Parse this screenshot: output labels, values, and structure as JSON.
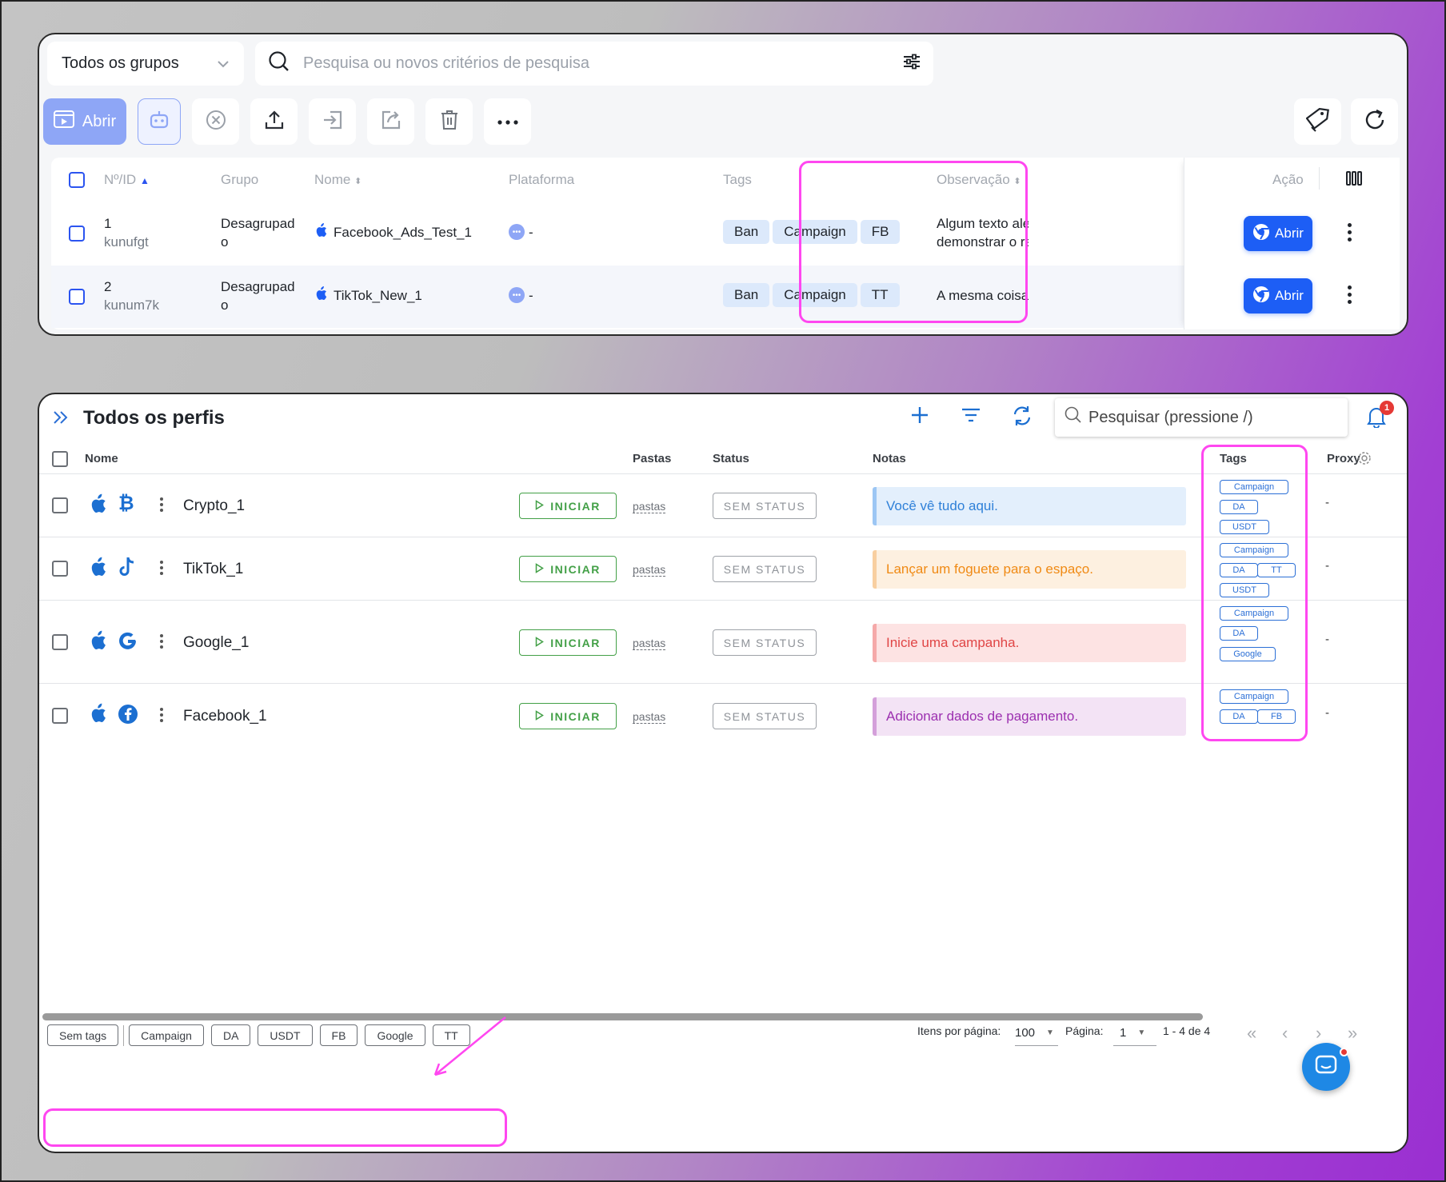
{
  "top": {
    "group_select": "Todos os grupos",
    "search_placeholder": "Pesquisa ou novos critérios de pesquisa",
    "open_label": "Abrir",
    "columns": {
      "id": "Nº/ID",
      "group": "Grupo",
      "name": "Nome",
      "platform": "Plataforma",
      "tags": "Tags",
      "observation": "Observação",
      "action": "Ação"
    },
    "rows": [
      {
        "num": "1",
        "id": "kunufgt",
        "group_line1": "Desagrupad",
        "group_line2": "o",
        "name": "Facebook_Ads_Test_1",
        "platform": "-",
        "tags": [
          "Ban",
          "Campaign",
          "FB"
        ],
        "obs_line1": "Algum texto aleat",
        "obs_line2": "demonstrar o recu",
        "action": "Abrir"
      },
      {
        "num": "2",
        "id": "kunum7k",
        "group_line1": "Desagrupad",
        "group_line2": "o",
        "name": "TikTok_New_1",
        "platform": "-",
        "tags": [
          "Ban",
          "Campaign",
          "TT"
        ],
        "obs_line1": "A mesma coisa a",
        "obs_line2": "",
        "action": "Abrir"
      }
    ]
  },
  "bottom": {
    "title": "Todos os perfis",
    "search_placeholder": "Pesquisar (pressione /)",
    "notification_count": "1",
    "columns": {
      "name": "Nome",
      "folders": "Pastas",
      "status": "Status",
      "notes": "Notas",
      "tags": "Tags",
      "proxy": "Proxy"
    },
    "start_label": "INICIAR",
    "folders_label": "pastas",
    "status_label": "SEM STATUS",
    "proxy_value": "-",
    "rows": [
      {
        "name": "Crypto_1",
        "app_icon": "bitcoin-icon",
        "note": "Você vê tudo aqui.",
        "note_color": "blue",
        "tags": [
          "Campaign",
          "DA",
          "USDT"
        ]
      },
      {
        "name": "TikTok_1",
        "app_icon": "tiktok-icon",
        "note": "Lançar um foguete para o espaço.",
        "note_color": "orange",
        "tags": [
          "Campaign",
          "DA",
          "TT",
          "USDT"
        ]
      },
      {
        "name": "Google_1",
        "app_icon": "google-icon",
        "note": "Inicie uma campanha.",
        "note_color": "red",
        "tags": [
          "Campaign",
          "DA",
          "Google"
        ]
      },
      {
        "name": "Facebook_1",
        "app_icon": "facebook-icon",
        "note": "Adicionar dados de pagamento.",
        "note_color": "purple",
        "tags": [
          "Campaign",
          "DA",
          "FB"
        ]
      }
    ],
    "footer_tags": [
      "Sem tags",
      "Campaign",
      "DA",
      "USDT",
      "FB",
      "Google",
      "TT"
    ],
    "items_per_page_label": "Itens por página:",
    "items_per_page": "100",
    "page_label": "Página:",
    "page": "1",
    "range": "1 - 4 de 4"
  },
  "colors": {
    "accent_blue": "#1d5ef5",
    "highlight_pink": "#ff47f0",
    "start_green": "#43a047"
  }
}
